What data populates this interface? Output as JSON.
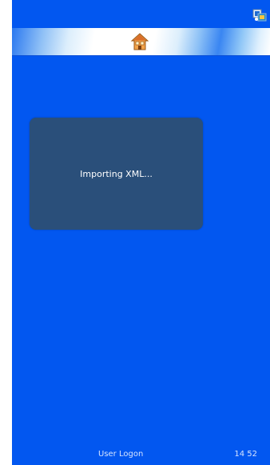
{
  "status_bar": {
    "tray_icon": "network-icon"
  },
  "header": {
    "home_icon": "home-icon"
  },
  "dialog": {
    "message": "Importing XML..."
  },
  "footer": {
    "user_label": "User Logon",
    "clock": "14 52"
  },
  "colors": {
    "background": "#0257f0",
    "dialog": "#2a4f7a",
    "header_highlight": "#ffffff"
  }
}
